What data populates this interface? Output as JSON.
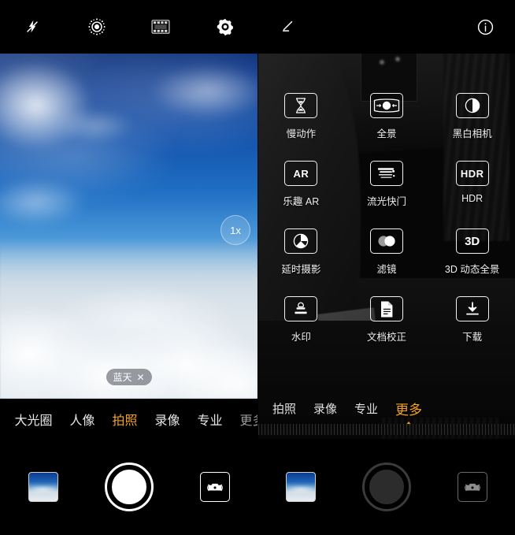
{
  "left_screen": {
    "topbar": [
      {
        "name": "flash-off-icon",
        "label": "flash-off"
      },
      {
        "name": "aperture-icon",
        "label": "aperture"
      },
      {
        "name": "video-icon",
        "label": "film"
      },
      {
        "name": "settings-icon",
        "label": "settings"
      }
    ],
    "viewfinder": {
      "zoom_level": "1x",
      "scene_tag": "蓝天",
      "scene_tag_close": "✕"
    },
    "modes": [
      {
        "label": "大光圈",
        "active": false
      },
      {
        "label": "人像",
        "active": false
      },
      {
        "label": "拍照",
        "active": true
      },
      {
        "label": "录像",
        "active": false
      },
      {
        "label": "专业",
        "active": false
      },
      {
        "label": "更多",
        "active": false
      }
    ],
    "controls": {
      "gallery": "gallery-thumbnail",
      "shutter": "shutter-button",
      "flip": "switch-camera"
    }
  },
  "right_screen": {
    "topbar": {
      "edit_icon": "edit-pencil",
      "info_icon": "info"
    },
    "more_modes": [
      {
        "label": "慢动作",
        "icon": "hourglass-icon"
      },
      {
        "label": "全景",
        "icon": "panorama-icon"
      },
      {
        "label": "黑白相机",
        "icon": "monochrome-icon"
      },
      {
        "label": "乐趣 AR",
        "icon": "ar-icon",
        "text": "AR"
      },
      {
        "label": "流光快门",
        "icon": "light-painting-icon"
      },
      {
        "label": "HDR",
        "icon": "hdr-icon",
        "text": "HDR"
      },
      {
        "label": "延时摄影",
        "icon": "timelapse-icon"
      },
      {
        "label": "滤镜",
        "icon": "filter-icon"
      },
      {
        "label": "3D 动态全景",
        "icon": "three-d-icon",
        "text": "3D"
      },
      {
        "label": "水印",
        "icon": "watermark-stamp-icon"
      },
      {
        "label": "文档校正",
        "icon": "document-correction-icon"
      },
      {
        "label": "下载",
        "icon": "download-icon"
      }
    ],
    "modes": [
      {
        "label": "拍照",
        "active": false
      },
      {
        "label": "录像",
        "active": false
      },
      {
        "label": "专业",
        "active": false
      },
      {
        "label": "更多",
        "active": true
      }
    ],
    "controls": {
      "gallery": "gallery-thumbnail",
      "shutter": "shutter-button",
      "flip": "switch-camera"
    }
  },
  "colors": {
    "accent": "#f3a220",
    "text": "#ffffff",
    "background": "#000000"
  }
}
